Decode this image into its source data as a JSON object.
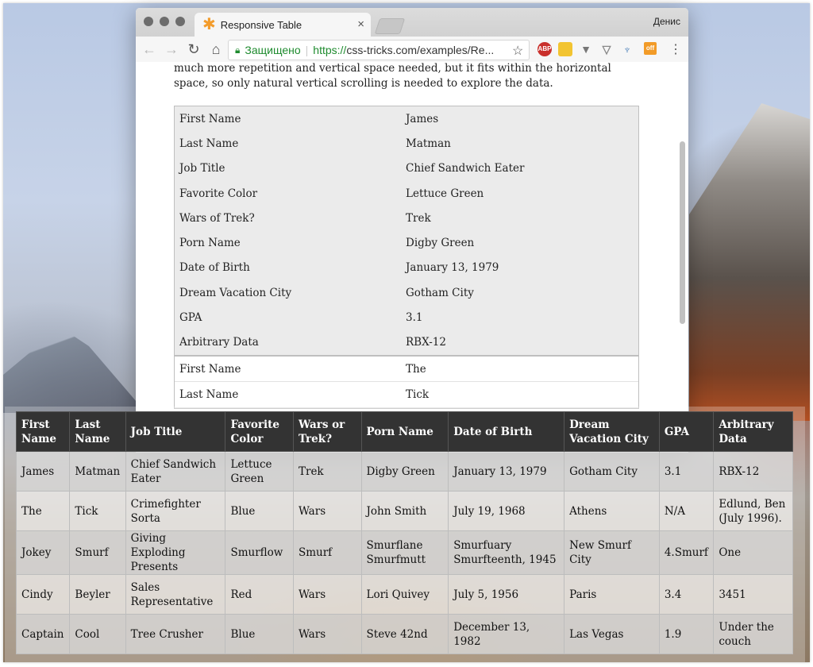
{
  "browser": {
    "tab_title": "Responsive Table",
    "user_name": "Денис",
    "secure_label": "Защищено",
    "url_scheme": "https://",
    "url_rest": "css-tricks.com/examples/Re...",
    "ext_abp": "ABP",
    "ext_off": "off"
  },
  "page": {
    "intro_text": "much more repetition and vertical space needed, but it fits within the horizontal space, so only natural vertical scrolling is needed to explore the data."
  },
  "card1": [
    {
      "key": "First Name",
      "value": "James"
    },
    {
      "key": "Last Name",
      "value": "Matman"
    },
    {
      "key": "Job Title",
      "value": "Chief Sandwich Eater"
    },
    {
      "key": "Favorite Color",
      "value": "Lettuce Green"
    },
    {
      "key": "Wars of Trek?",
      "value": "Trek"
    },
    {
      "key": "Porn Name",
      "value": "Digby Green"
    },
    {
      "key": "Date of Birth",
      "value": "January 13, 1979"
    },
    {
      "key": "Dream Vacation City",
      "value": "Gotham City"
    },
    {
      "key": "GPA",
      "value": "3.1"
    },
    {
      "key": "Arbitrary Data",
      "value": "RBX-12"
    }
  ],
  "card2": [
    {
      "key": "First Name",
      "value": "The"
    },
    {
      "key": "Last Name",
      "value": "Tick"
    }
  ],
  "table": {
    "headers": [
      "First Name",
      "Last Name",
      "Job Title",
      "Favorite Color",
      "Wars or Trek?",
      "Porn Name",
      "Date of Birth",
      "Dream Vacation City",
      "GPA",
      "Arbitrary Data"
    ],
    "rows": [
      [
        "James",
        "Matman",
        "Chief Sandwich Eater",
        "Lettuce Green",
        "Trek",
        "Digby Green",
        "January 13, 1979",
        "Gotham City",
        "3.1",
        "RBX-12"
      ],
      [
        "The",
        "Tick",
        "Crimefighter Sorta",
        "Blue",
        "Wars",
        "John Smith",
        "July 19, 1968",
        "Athens",
        "N/A",
        "Edlund, Ben (July 1996)."
      ],
      [
        "Jokey",
        "Smurf",
        "Giving Exploding Presents",
        "Smurflow",
        "Smurf",
        "Smurflane Smurfmutt",
        "Smurfuary Smurfteenth, 1945",
        "New Smurf City",
        "4.Smurf",
        "One"
      ],
      [
        "Cindy",
        "Beyler",
        "Sales Representative",
        "Red",
        "Wars",
        "Lori Quivey",
        "July 5, 1956",
        "Paris",
        "3.4",
        "3451"
      ],
      [
        "Captain",
        "Cool",
        "Tree Crusher",
        "Blue",
        "Wars",
        "Steve 42nd",
        "December 13, 1982",
        "Las Vegas",
        "1.9",
        "Under the couch"
      ]
    ]
  }
}
